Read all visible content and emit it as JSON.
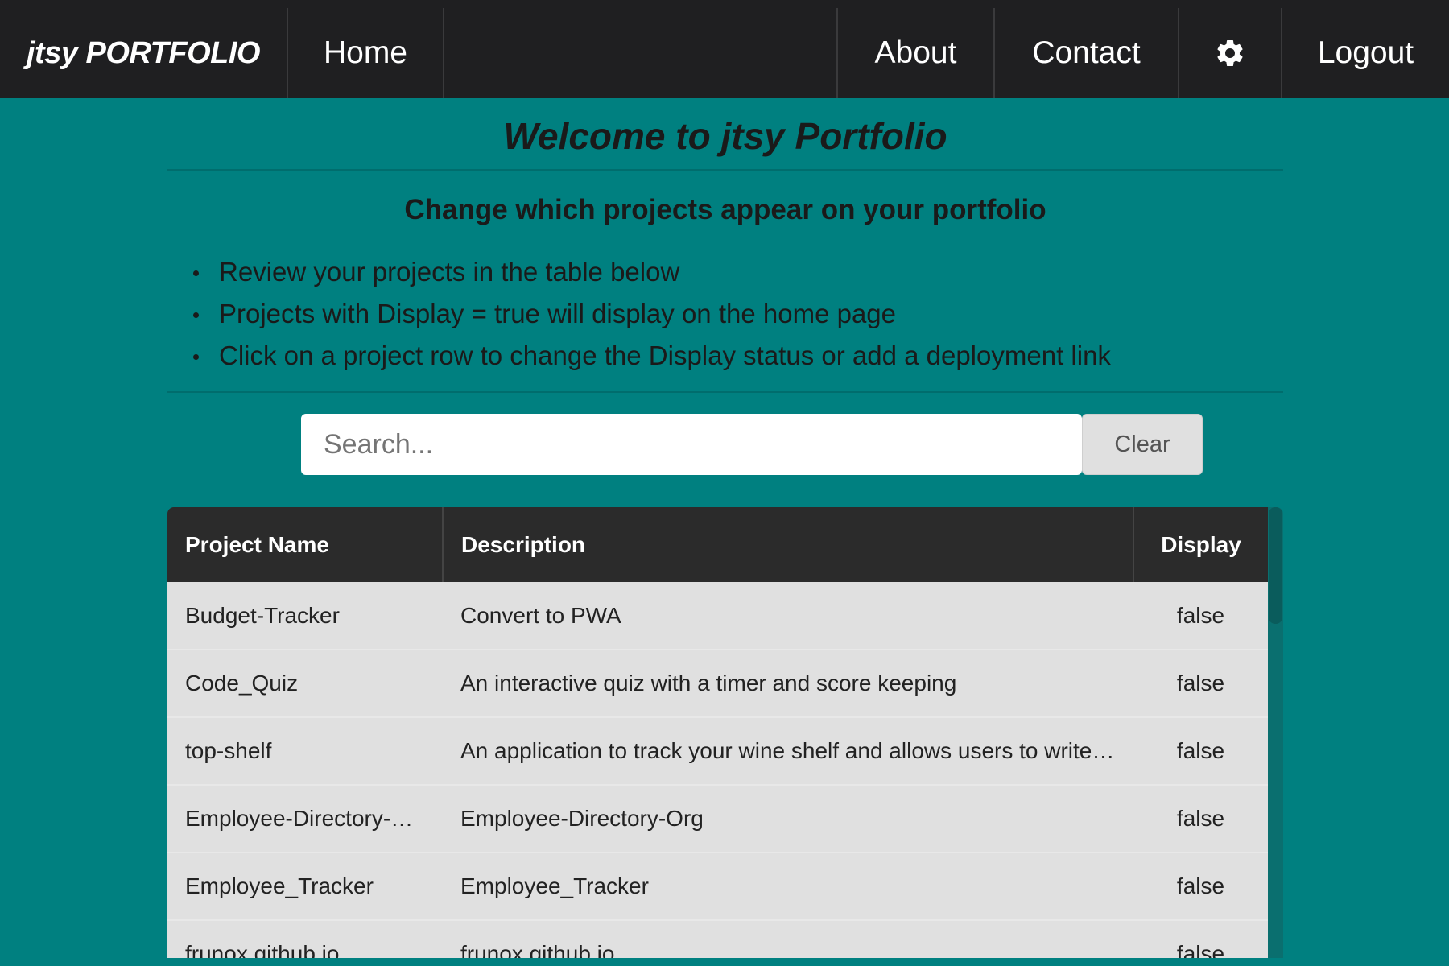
{
  "nav": {
    "brand": "jtsy PORTFOLIO",
    "home": "Home",
    "about": "About",
    "contact": "Contact",
    "settings_icon": "gear-icon",
    "logout": "Logout"
  },
  "header": {
    "title": "Welcome to jtsy Portfolio",
    "subtitle": "Change which projects appear on your portfolio",
    "instructions": [
      "Review your projects in the table below",
      "Projects with Display = true will display on the home page",
      "Click on a project row to change the Display status or add a deployment link"
    ]
  },
  "search": {
    "placeholder": "Search...",
    "value": "",
    "clear_label": "Clear"
  },
  "table": {
    "columns": [
      "Project Name",
      "Description",
      "Display"
    ],
    "rows": [
      {
        "name": "Budget-Tracker",
        "description": "Convert to PWA",
        "display": "false"
      },
      {
        "name": "Code_Quiz",
        "description": "An interactive quiz with a timer and score keeping",
        "display": "false"
      },
      {
        "name": "top-shelf",
        "description": "An application to track your wine shelf and allows users to write…",
        "display": "false"
      },
      {
        "name": "Employee-Directory-…",
        "description": "Employee-Directory-Org",
        "display": "false"
      },
      {
        "name": "Employee_Tracker",
        "description": "Employee_Tracker",
        "display": "false"
      },
      {
        "name": "frunox.github.io",
        "description": "frunox.github.io",
        "display": "false"
      }
    ]
  },
  "colors": {
    "background": "#008080",
    "navbar": "#1f1f21",
    "table_header": "#2b2b2b",
    "table_row": "#e0e0e0"
  }
}
